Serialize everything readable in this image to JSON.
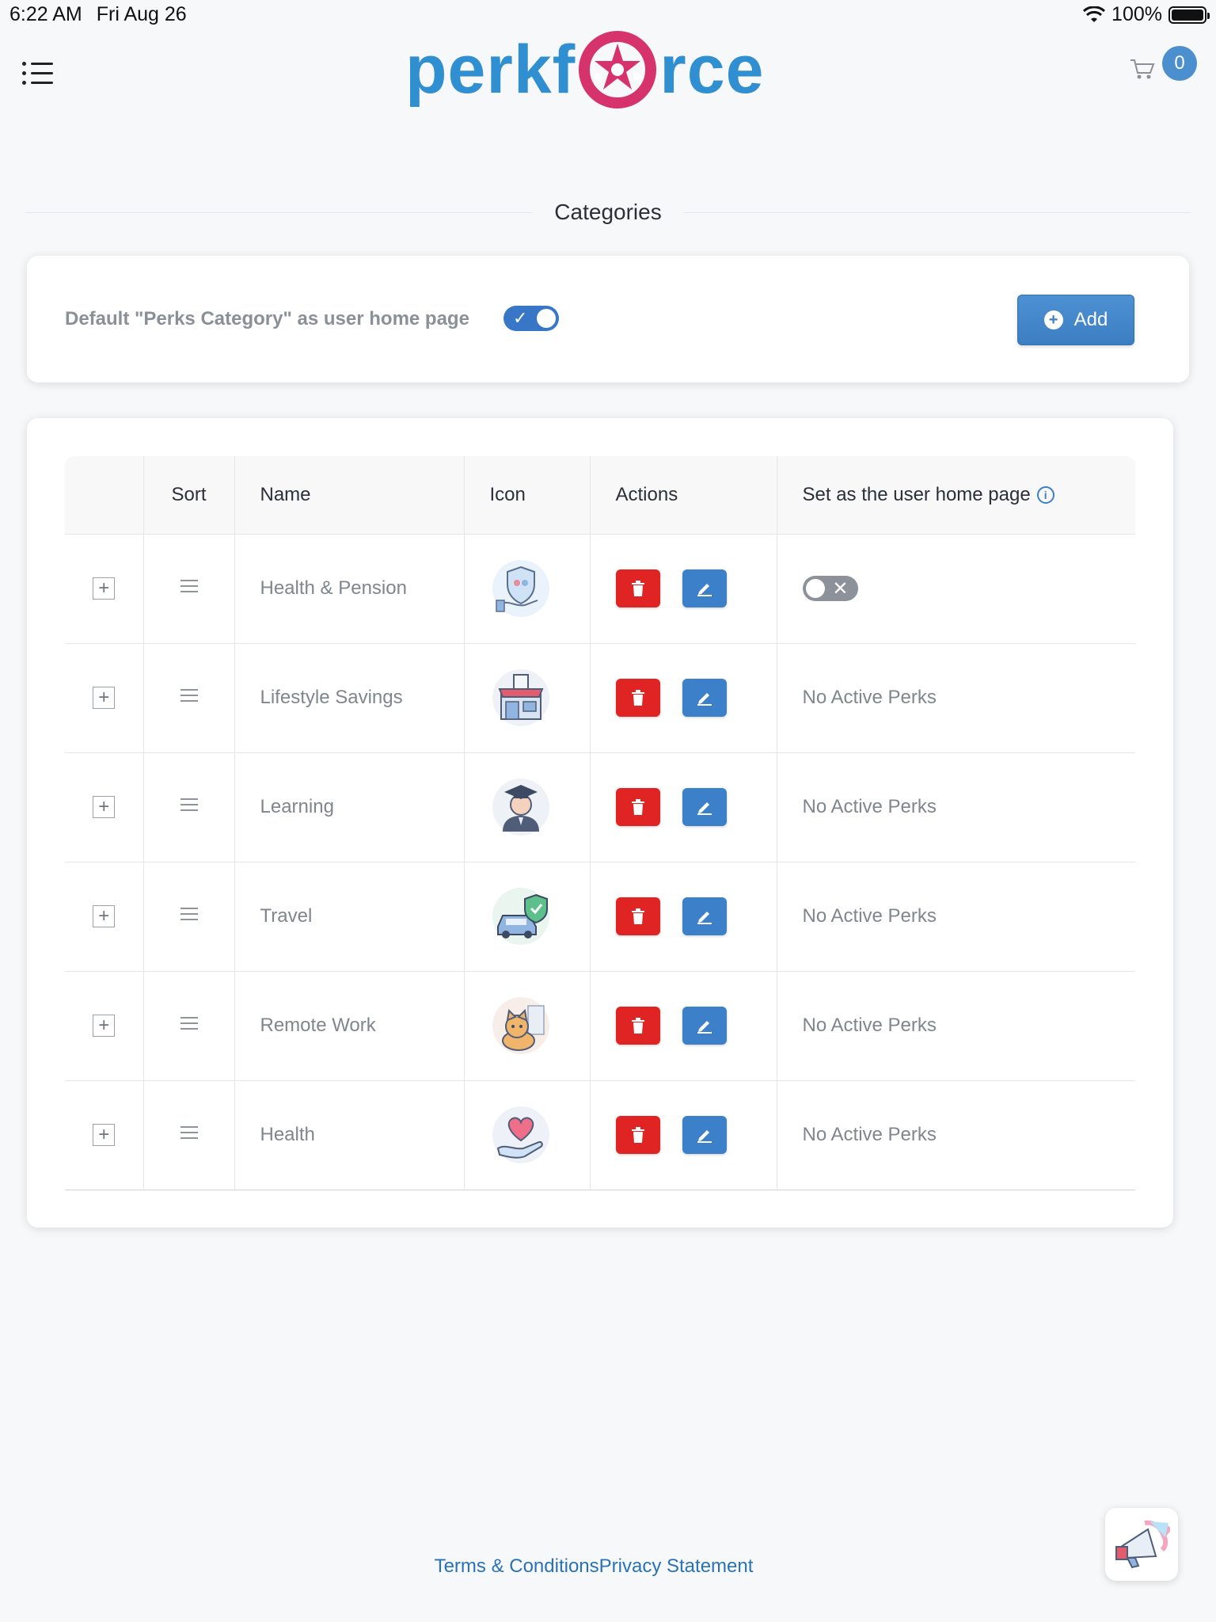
{
  "status_bar": {
    "time": "6:22 AM",
    "date": "Fri Aug 26",
    "battery": "100%"
  },
  "header": {
    "logo_left": "perkf",
    "logo_right": "rce",
    "cart_count": "0",
    "menu_icon": "list-menu-icon",
    "cart_icon": "cart-icon"
  },
  "page": {
    "title": "Categories"
  },
  "settings": {
    "default_label": "Default \"Perks Category\" as user home page",
    "default_toggle_on": true,
    "add_label": "Add"
  },
  "table": {
    "headers": {
      "expand": "",
      "sort": "Sort",
      "name": "Name",
      "icon": "Icon",
      "actions": "Actions",
      "home_page": "Set as the user home page"
    },
    "rows": [
      {
        "name": "Health & Pension",
        "icon": "health-pension-icon",
        "home_page": "",
        "home_toggle": "off"
      },
      {
        "name": "Lifestyle Savings",
        "icon": "store-icon",
        "home_page": "No Active Perks"
      },
      {
        "name": "Learning",
        "icon": "graduate-icon",
        "home_page": "No Active Perks"
      },
      {
        "name": "Travel",
        "icon": "car-shield-icon",
        "home_page": "No Active Perks"
      },
      {
        "name": "Remote Work",
        "icon": "cat-icon",
        "home_page": "No Active Perks"
      },
      {
        "name": "Health",
        "icon": "heart-hand-icon",
        "home_page": "No Active Perks"
      }
    ]
  },
  "footer": {
    "terms": "Terms & Conditions",
    "privacy": "Privacy Statement"
  },
  "colors": {
    "brand_blue": "#2f8fd0",
    "brand_pink": "#d6336c",
    "delete_red": "#e02424",
    "edit_blue": "#3b80c8"
  }
}
